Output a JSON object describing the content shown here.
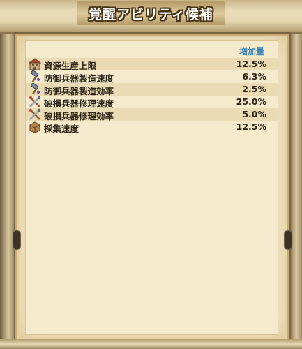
{
  "dialog": {
    "title": "覚醒アビリティ候補",
    "column_header": "増加量"
  },
  "abilities": [
    {
      "label": "資源生産上限",
      "value": "12.5%",
      "icon": "storehouse-icon"
    },
    {
      "label": "防御兵器製造速度",
      "value": "6.3%",
      "icon": "hammer-icon"
    },
    {
      "label": "防御兵器製造効率",
      "value": "2.5%",
      "icon": "hammer-icon"
    },
    {
      "label": "破損兵器修理速度",
      "value": "25.0%",
      "icon": "crossed-tools-icon"
    },
    {
      "label": "破損兵器修理効率",
      "value": "5.0%",
      "icon": "crossed-tools-icon"
    },
    {
      "label": "採集速度",
      "value": "12.5%",
      "icon": "resource-crate-icon"
    }
  ],
  "colors": {
    "accent": "#3f83b6",
    "parchment": "#f5ebcc",
    "text": "#2d2418"
  }
}
